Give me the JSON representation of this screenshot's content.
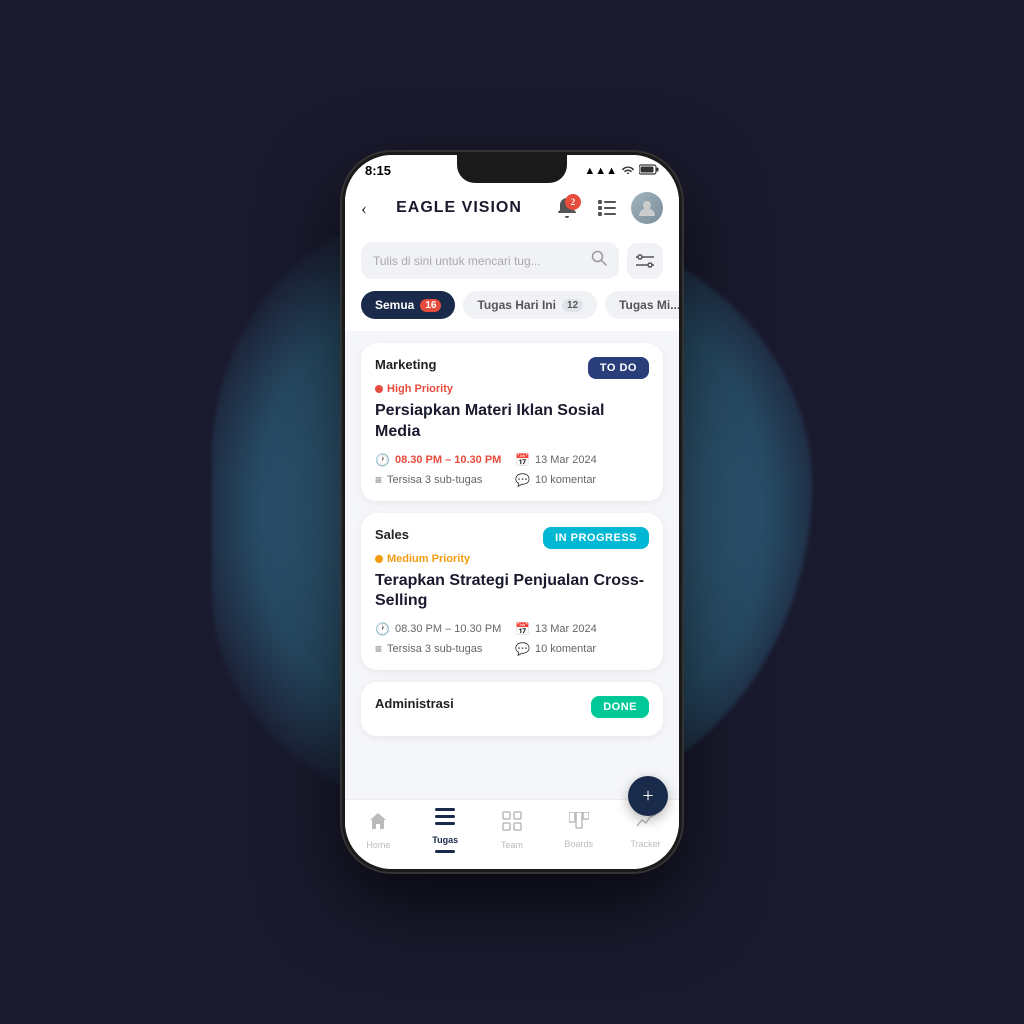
{
  "phone": {
    "status_time": "8:15",
    "status_signal": "▲▲▲",
    "status_wifi": "WiFi",
    "status_battery": "🔋"
  },
  "header": {
    "back_label": "‹",
    "title": "EAGLE VISION",
    "notification_badge": "2",
    "list_icon": "📋",
    "avatar_letter": "👤"
  },
  "search": {
    "placeholder": "Tulis di sini untuk mencari tug...",
    "search_icon": "🔍",
    "filter_icon": "⚙"
  },
  "tabs": [
    {
      "id": "semua",
      "label": "Semua",
      "badge": "16",
      "active": true,
      "badge_style": "red"
    },
    {
      "id": "hari-ini",
      "label": "Tugas Hari Ini",
      "badge": "12",
      "active": false,
      "badge_style": "light"
    },
    {
      "id": "minggu",
      "label": "Tugas Mi...",
      "badge": "",
      "active": false,
      "badge_style": "none"
    }
  ],
  "tasks": [
    {
      "id": "task1",
      "category": "Marketing",
      "status": "TO DO",
      "status_type": "todo",
      "priority": "High Priority",
      "priority_type": "high",
      "title": "Persiapkan Materi Iklan Sosial Media",
      "time_start": "08.30 PM",
      "time_end": "10.30 PM",
      "date": "13 Mar 2024",
      "sub_tasks": "Tersisa 3 sub-tugas",
      "comments": "10 komentar",
      "time_urgent": true
    },
    {
      "id": "task2",
      "category": "Sales",
      "status": "IN PROGRESS",
      "status_type": "inprogress",
      "priority": "Medium Priority",
      "priority_type": "medium",
      "title": "Terapkan Strategi Penjualan Cross-Selling",
      "time_start": "08.30 PM",
      "time_end": "10.30 PM",
      "date": "13 Mar 2024",
      "sub_tasks": "Tersisa 3 sub-tugas",
      "comments": "10 komentar",
      "time_urgent": false
    },
    {
      "id": "task3",
      "category": "Administrasi",
      "status": "DONE",
      "status_type": "done",
      "priority": "",
      "priority_type": "",
      "title": "",
      "partial": true
    }
  ],
  "bottom_nav": [
    {
      "id": "home",
      "icon": "⌂",
      "label": "Home",
      "active": false
    },
    {
      "id": "tasks",
      "icon": "☰",
      "label": "Tugas",
      "active": true
    },
    {
      "id": "team",
      "icon": "⊞",
      "label": "Team",
      "active": false
    },
    {
      "id": "boards",
      "icon": "▦",
      "label": "Boards",
      "active": false
    },
    {
      "id": "tracker",
      "icon": "📈",
      "label": "Tracker",
      "active": false
    }
  ],
  "fab": {
    "label": "+"
  },
  "colors": {
    "todo_bg": "#2a3f7a",
    "inprogress_bg": "#00b8d4",
    "done_bg": "#00c896",
    "high_priority": "#e74c3c",
    "medium_priority": "#f39c12",
    "nav_active": "#1a2a4a"
  }
}
